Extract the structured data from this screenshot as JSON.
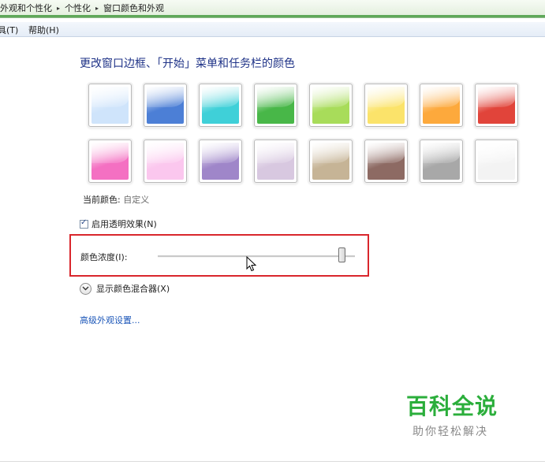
{
  "breadcrumb": {
    "items": [
      "外观和个性化",
      "个性化",
      "窗口颜色和外观"
    ],
    "separator": "▸"
  },
  "menubar": {
    "items": [
      "具(T)",
      "帮助(H)"
    ]
  },
  "main": {
    "heading": "更改窗口边框、「开始」菜单和任务栏的颜色",
    "swatches": [
      {
        "name": "sky",
        "color": "#cfe4fb"
      },
      {
        "name": "twilight",
        "color": "#4c7fd6"
      },
      {
        "name": "sea",
        "color": "#3fd0d8"
      },
      {
        "name": "leaf",
        "color": "#48b748"
      },
      {
        "name": "lime",
        "color": "#a8dc5a"
      },
      {
        "name": "pumpkin",
        "color": "#fbe36a"
      },
      {
        "name": "tangerine",
        "color": "#fda93c"
      },
      {
        "name": "ruby",
        "color": "#e1443a"
      },
      {
        "name": "fuchsia",
        "color": "#f470c2"
      },
      {
        "name": "blush",
        "color": "#fbc7ee"
      },
      {
        "name": "violet",
        "color": "#9f86c9"
      },
      {
        "name": "lavender",
        "color": "#d8c8e0"
      },
      {
        "name": "taupe",
        "color": "#c6b496"
      },
      {
        "name": "chocolate",
        "color": "#8d6a63"
      },
      {
        "name": "slate",
        "color": "#a8a8a8"
      },
      {
        "name": "frost",
        "color": "#f3f3f3"
      }
    ],
    "current_color_label": "当前颜色:",
    "current_color_value": "自定义",
    "transparency_label": "启用透明效果(N)",
    "transparency_checked": true,
    "intensity_label": "颜色浓度(I):",
    "intensity_value": 0.93,
    "mixer_label": "显示颜色混合器(X)",
    "advanced_link": "高级外观设置..."
  },
  "watermark": {
    "title": "百科全说",
    "subtitle": "助你轻松解决"
  },
  "colors": {
    "accent_green": "#5fa859",
    "highlight_red": "#d9262c",
    "link_blue": "#1b56b8",
    "heading_blue": "#1e3287"
  }
}
